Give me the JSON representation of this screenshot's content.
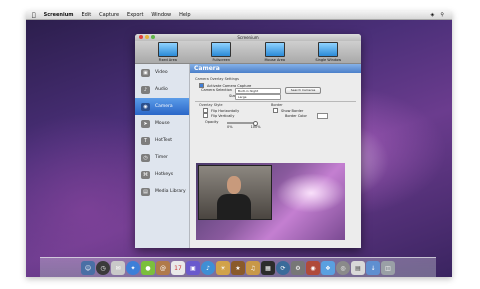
{
  "menubar": {
    "items": [
      "Screenium",
      "Edit",
      "Capture",
      "Export",
      "Window",
      "Help"
    ]
  },
  "window": {
    "title": "Screenium",
    "toolbar": [
      {
        "label": "Fixed Area",
        "icon": "fixed-area-icon"
      },
      {
        "label": "Fullscreen",
        "icon": "fullscreen-icon"
      },
      {
        "label": "Mouse Area",
        "icon": "mouse-area-icon"
      },
      {
        "label": "Single Window",
        "icon": "single-window-icon"
      }
    ]
  },
  "sidebar": {
    "items": [
      {
        "label": "Video",
        "icon": "video-icon",
        "active": false
      },
      {
        "label": "Audio",
        "icon": "audio-icon",
        "active": false
      },
      {
        "label": "Camera",
        "icon": "camera-icon",
        "active": true
      },
      {
        "label": "Mouse",
        "icon": "mouse-icon",
        "active": false
      },
      {
        "label": "HotText",
        "icon": "hottext-icon",
        "active": false
      },
      {
        "label": "Timer",
        "icon": "timer-icon",
        "active": false
      },
      {
        "label": "Hotkeys",
        "icon": "hotkeys-icon",
        "active": false
      },
      {
        "label": "Media Library",
        "icon": "media-library-icon",
        "active": false
      }
    ]
  },
  "camera": {
    "header": "Camera",
    "overlay_title": "Camera Overlay Settings",
    "activate_label": "Activate Camera Capture",
    "camera_selection_label": "Camera Selection",
    "camera_selection_value": "Built-in iSight",
    "search_button": "Search Cameras",
    "size_label": "Size",
    "size_value": "Large",
    "overlay_style_label": "Overlay Style",
    "flip_h_label": "Flip Horizontally",
    "flip_v_label": "Flip Vertically",
    "opacity_label": "Opacity",
    "opacity_min": "0%",
    "opacity_max": "100%",
    "border_label": "Border",
    "show_border_label": "Show Border",
    "border_color_label": "Border Color"
  },
  "colors": {
    "accent": "#3a78d6",
    "sidebar_bg": "#dfe5ee"
  }
}
